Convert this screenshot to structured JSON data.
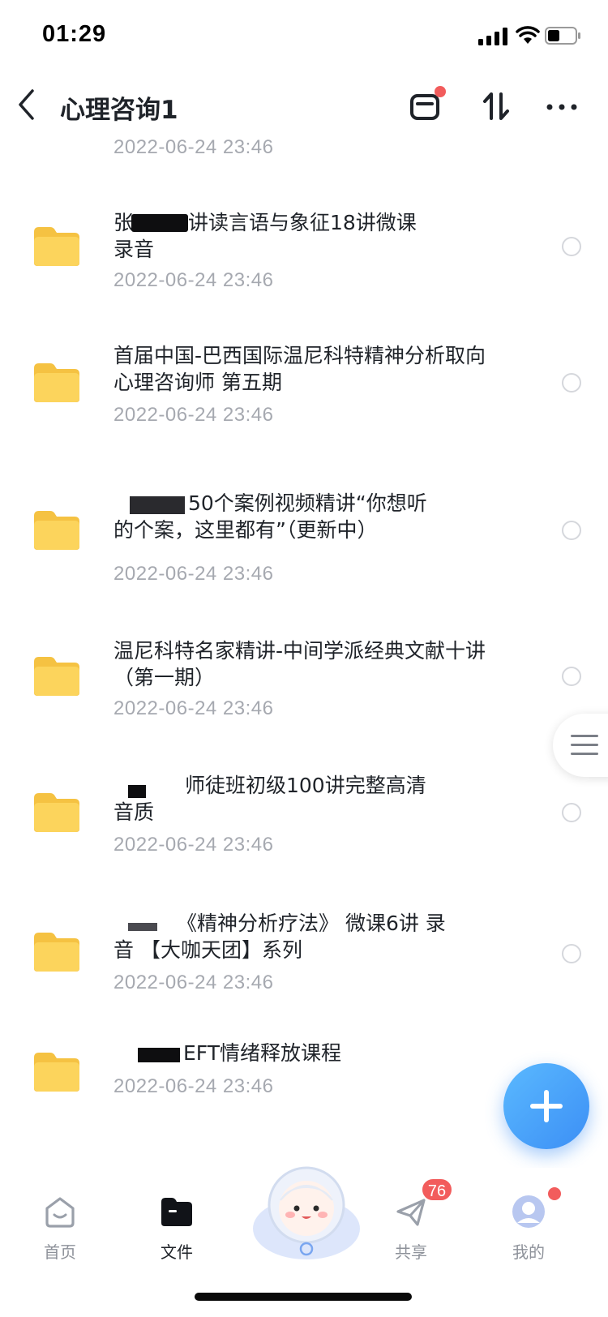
{
  "status_bar": {
    "time": "01:29"
  },
  "header": {
    "title": "心理咨询1"
  },
  "list": {
    "top_date": "2022-06-24 23:46",
    "items": [
      {
        "name": "张...讲读言语与象征18讲微课录音",
        "name_visible": "讲读言语与象征18讲微课\n录音",
        "date": "2022-06-24 23:46"
      },
      {
        "name": "首届中国-巴西国际温尼科特精神分析取向心理咨询师 第五期",
        "date": "2022-06-24 23:46"
      },
      {
        "name": "50个案例视频精讲“你想听的个案，这里都有”（更新中）",
        "date": "2022-06-24 23:46"
      },
      {
        "name": "温尼科特名家精讲-中间学派经典文献十讲（第一期）",
        "date": "2022-06-24 23:46"
      },
      {
        "name": "师徒班初级100讲完整高清音质",
        "date": "2022-06-24 23:46"
      },
      {
        "name": "《精神分析疗法》 微课6讲 录音 【大咖天团】系列",
        "date": "2022-06-24 23:46"
      },
      {
        "name": "EFT情绪释放课程",
        "date": "2022-06-24 23:46"
      }
    ]
  },
  "tabbar": {
    "tabs": [
      {
        "label": "首页",
        "icon": "home-icon"
      },
      {
        "label": "文件",
        "icon": "folder-icon"
      },
      {
        "label": "共享",
        "icon": "send-icon",
        "badge": "76"
      },
      {
        "label": "我的",
        "icon": "avatar-icon"
      }
    ]
  },
  "colors": {
    "accent": "#3c8ff5",
    "badge": "#f25c5c",
    "date_text": "#a6a9b0",
    "folder": "#fcd45c"
  }
}
